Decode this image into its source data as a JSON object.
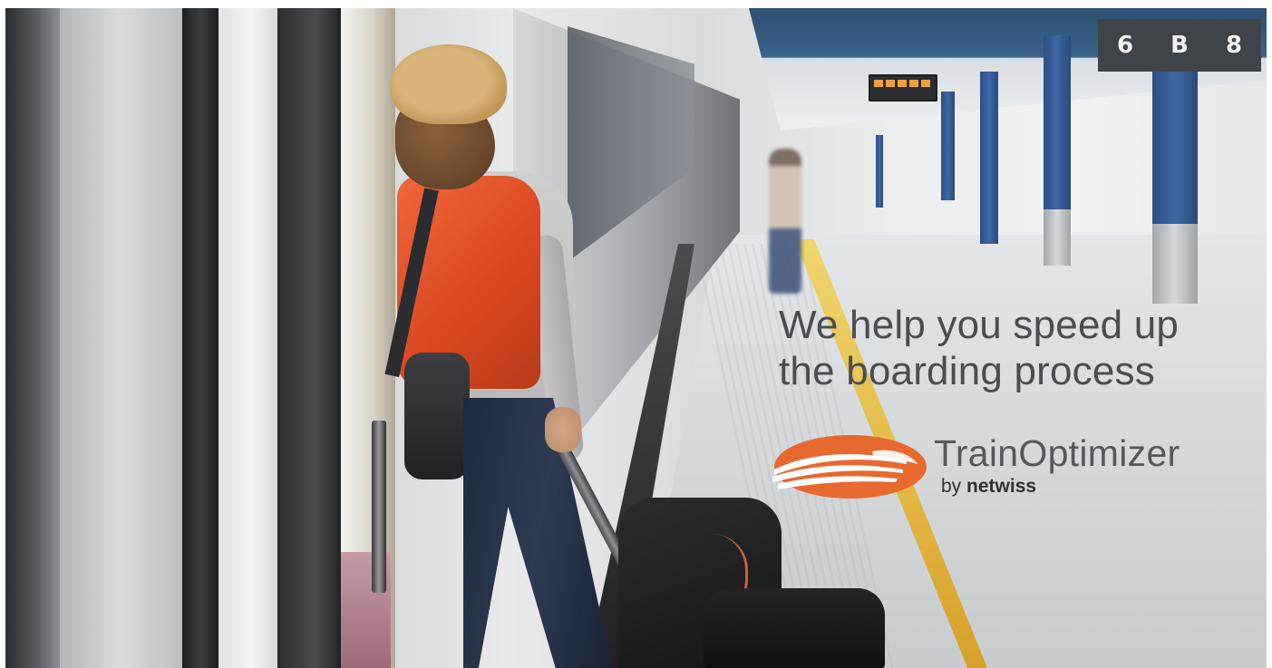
{
  "banner": {
    "headline_line1": "We help you speed up",
    "headline_line2": "the boarding process",
    "product_name": "TrainOptimizer",
    "by_prefix": "by",
    "company_name": "netwiss"
  },
  "station_sign": {
    "chars": [
      "6",
      "B",
      "8"
    ]
  },
  "colors": {
    "brand_orange": "#E8692F",
    "text_gray": "#4A4D52",
    "platform_stripe": "#E2B540"
  },
  "icons": {
    "logo": "train-front-swoosh-icon"
  }
}
